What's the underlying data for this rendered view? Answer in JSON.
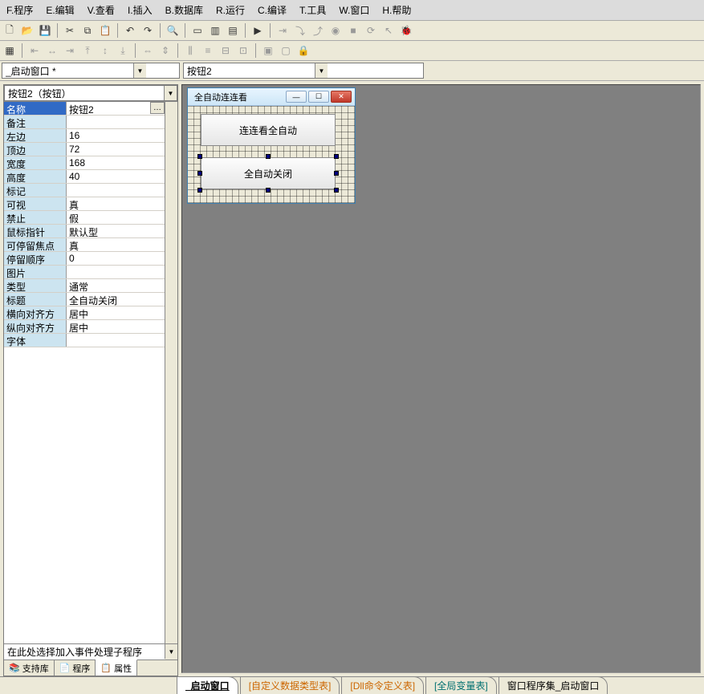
{
  "menu": {
    "items": [
      "F.程序",
      "E.编辑",
      "V.查看",
      "I.插入",
      "B.数据库",
      "R.运行",
      "C.编译",
      "T.工具",
      "W.窗口",
      "H.帮助"
    ]
  },
  "combos": {
    "window": "_启动窗口 *",
    "control": "按钮2"
  },
  "left": {
    "selector": "按钮2（按钮）",
    "event_placeholder": "在此处选择加入事件处理子程序"
  },
  "props": [
    {
      "key": "名称",
      "val": "按钮2",
      "selected": true,
      "ellipsis": true
    },
    {
      "key": "备注",
      "val": ""
    },
    {
      "key": "左边",
      "val": "16"
    },
    {
      "key": "顶边",
      "val": "72"
    },
    {
      "key": "宽度",
      "val": "168"
    },
    {
      "key": "高度",
      "val": "40"
    },
    {
      "key": "标记",
      "val": ""
    },
    {
      "key": "可视",
      "val": "真"
    },
    {
      "key": "禁止",
      "val": "假"
    },
    {
      "key": "鼠标指针",
      "val": "默认型"
    },
    {
      "key": "可停留焦点",
      "val": "真"
    },
    {
      "key": "停留顺序",
      "val": "0"
    },
    {
      "key": "图片",
      "val": ""
    },
    {
      "key": "类型",
      "val": "通常"
    },
    {
      "key": "标题",
      "val": "全自动关闭"
    },
    {
      "key": "横向对齐方式",
      "val": "居中"
    },
    {
      "key": "纵向对齐方式",
      "val": "居中"
    },
    {
      "key": "字体",
      "val": ""
    }
  ],
  "panel_tabs": {
    "lib": "支持库",
    "prog": "程序",
    "prop": "属性"
  },
  "form": {
    "title": "全自动连连看",
    "button1_label": "连连看全自动",
    "button2_label": "全自动关闭"
  },
  "bottom_tabs": {
    "t1": "_启动窗口",
    "t2": "[自定义数据类型表]",
    "t3": "[Dll命令定义表]",
    "t4": "[全局变量表]",
    "t5": "窗口程序集_启动窗口"
  }
}
